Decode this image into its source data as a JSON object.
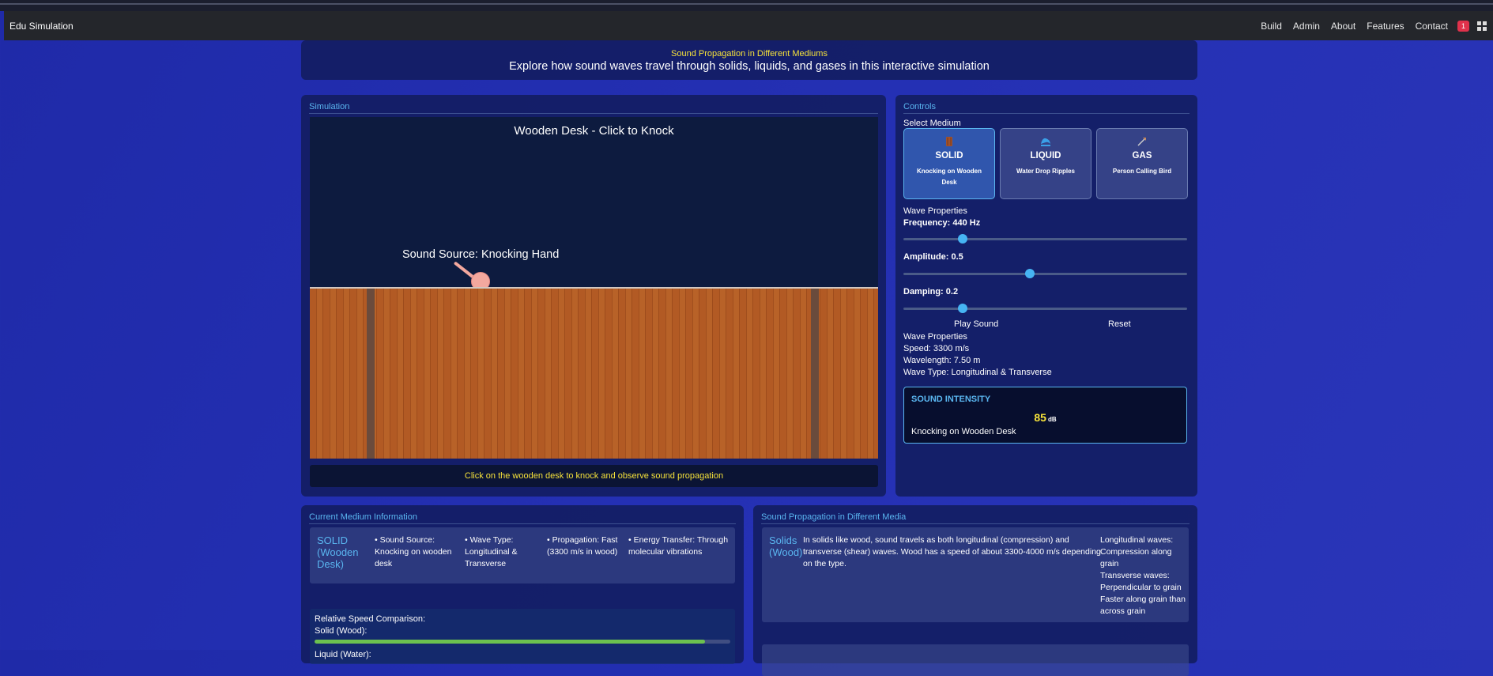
{
  "navbar": {
    "brand": "Edu Simulation",
    "links": [
      "Build",
      "Admin",
      "About",
      "Features",
      "Contact"
    ],
    "notification_count": "1"
  },
  "header": {
    "subtitle": "Sound Propagation in Different Mediums",
    "title": "Explore how sound waves travel through solids, liquids, and gases in this interactive simulation"
  },
  "simulation": {
    "panel_title": "Simulation",
    "canvas_title": "Wooden Desk - Click to Knock",
    "source_label": "Sound Source: Knocking Hand",
    "caption": "Click on the wooden desk to knock and observe sound propagation"
  },
  "controls": {
    "panel_title": "Controls",
    "select_medium_label": "Select Medium",
    "mediums": [
      {
        "name": "SOLID",
        "desc": "Knocking on Wooden Desk",
        "icon": "wood-icon",
        "active": true
      },
      {
        "name": "LIQUID",
        "desc": "Water Drop Ripples",
        "icon": "water-wave-icon",
        "active": false
      },
      {
        "name": "GAS",
        "desc": "Person Calling Bird",
        "icon": "bird-icon",
        "active": false
      }
    ],
    "wave_properties_label": "Wave Properties",
    "frequency_label": "Frequency: 440 Hz",
    "frequency_level": 0.21,
    "amplitude_label": "Amplitude: 0.5",
    "amplitude_level": 0.445,
    "damping_label": "Damping: 0.2",
    "damping_level": 0.21,
    "play_label": "Play Sound",
    "reset_label": "Reset",
    "wave_props": {
      "title": "Wave Properties",
      "speed": "Speed: 3300 m/s",
      "wavelength": "Wavelength: 7.50 m",
      "wave_type": "Wave Type: Longitudinal & Transverse"
    },
    "intensity": {
      "title": "SOUND INTENSITY",
      "value": "85",
      "unit": "dB",
      "source": "Knocking on Wooden Desk"
    }
  },
  "medium_info": {
    "panel_title": "Current Medium Information",
    "medium_name": "SOLID (Wooden Desk)",
    "facts": [
      "• Sound Source: Knocking on wooden desk",
      "• Wave Type: Longitudinal & Transverse",
      "• Propagation: Fast (3300 m/s in wood)",
      "• Energy Transfer: Through molecular vibrations"
    ],
    "speed_comparison": {
      "title": "Relative Speed Comparison:",
      "solid_label": "Solid (Wood):",
      "solid_fraction": 0.94,
      "next_label": "Liquid (Water):"
    }
  },
  "propagation": {
    "panel_title": "Sound Propagation in Different Media",
    "medium_name": "Solids (Wood)",
    "description": "In solids like wood, sound travels as both longitudinal (compression) and transverse (shear) waves. Wood has a speed of about 3300-4000 m/s depending on the type.",
    "notes": [
      "Longitudinal waves: Compression along grain",
      "Transverse waves: Perpendicular to grain",
      "Faster along grain than across grain"
    ]
  },
  "colors": {
    "accent": "#5ab6f0",
    "highlight": "#f6e23a",
    "badge": "#e0314b",
    "progress": "#6cc14f"
  }
}
